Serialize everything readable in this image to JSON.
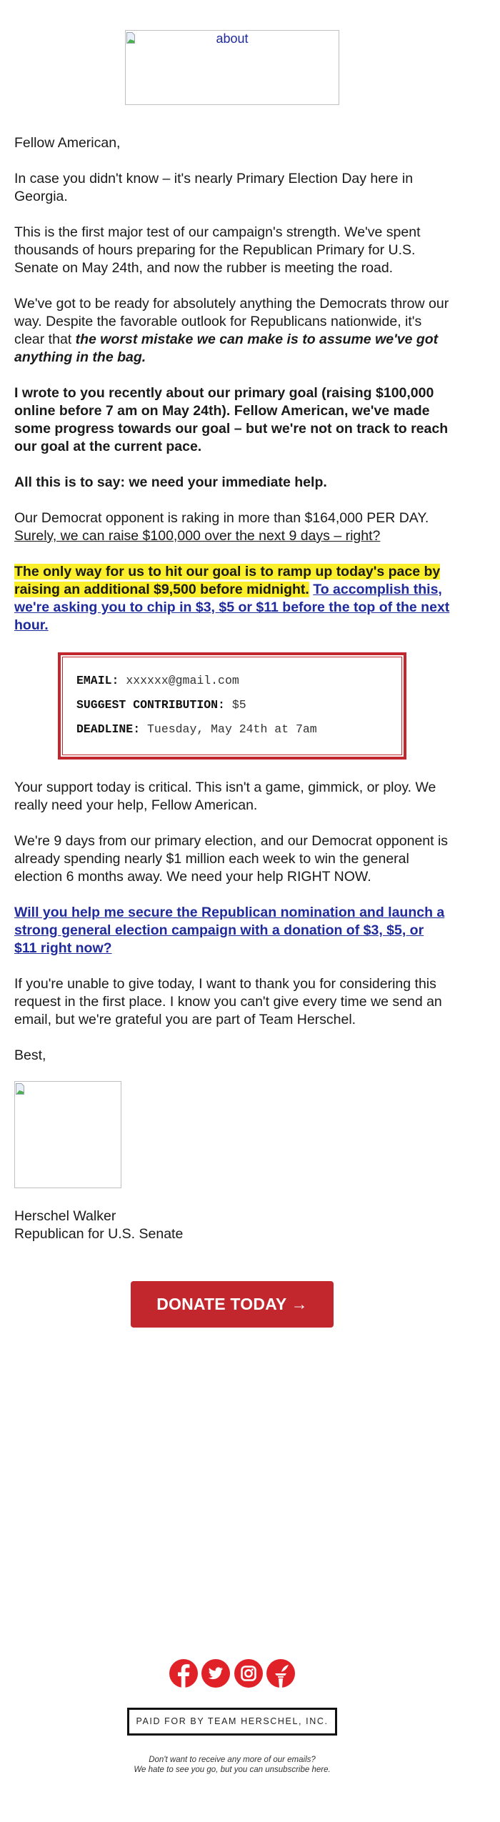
{
  "header": {
    "image_alt": "about"
  },
  "body": {
    "greeting": "Fellow American,",
    "p1": "In case you didn't know – it's nearly Primary Election Day here in Georgia.",
    "p2": "This is the first major test of our campaign's strength. We've spent thousands of hours preparing for the Republican Primary for U.S. Senate on May 24th, and now the rubber is meeting the road.",
    "p3_start": "We've got to be ready for absolutely anything the Democrats throw our way. Despite the favorable outlook for Republicans nationwide, it's clear that ",
    "p3_emphasis": "the worst mistake we can make is to assume we've got anything in the bag.",
    "p4": "I wrote to you recently about our primary goal (raising $100,000 online before 7 am on May 24th). Fellow American, we've made some progress towards our goal – but we're not on track to reach our goal at the current pace.",
    "p5": "All this is to say: we need your immediate help.",
    "p6_line1": "Our Democrat opponent is raking in more than $164,000 PER DAY.",
    "p6_underlined": "Surely, we can raise $100,000 over the next 9 days – right?",
    "p7_highlight": "The only way for us to hit our goal is to ramp up today's pace by raising an additional $9,500 before midnight.",
    "p7_link": "To accomplish this, we're asking you to chip in $3, $5 or $11 before the top of the next hour.",
    "p8": "Your support today is critical. This isn't a game, gimmick, or ploy. We really need your help, Fellow American.",
    "p9": "We're 9 days from our primary election, and our Democrat opponent is already spending nearly $1 million each week to win the general election 6 months away. We need your help RIGHT NOW.",
    "p10_link": "Will you help me secure the Republican nomination and launch a strong general election campaign with a donation of $3, $5, or $11 right now?",
    "p11": "If you're unable to give today, I want to thank you for considering this request in the first place. I know you can't give every time we send an email, but we're grateful you are part of Team Herschel.",
    "signoff": "Best,",
    "signer_name": "Herschel Walker",
    "signer_title": "Republican for U.S. Senate"
  },
  "info_box": {
    "email_label": "EMAIL",
    "email_value": "xxxxxx@gmail.com",
    "contribution_label": "SUGGEST CONTRIBUTION",
    "contribution_value": "$5",
    "deadline_label": "DEADLINE",
    "deadline_value": "Tuesday, May 24th at 7am"
  },
  "donate_button": {
    "label": "DONATE TODAY",
    "arrow": "→",
    "color": "#c1272d"
  },
  "social": {
    "color": "#e02127",
    "icons": [
      "facebook-icon",
      "twitter-icon",
      "instagram-icon",
      "winred-torch-icon"
    ]
  },
  "footer": {
    "paid_for": "PAID FOR BY TEAM HERSCHEL, INC.",
    "unsubscribe_line1": "Don't want to receive any more of our emails?",
    "unsubscribe_line2": "We hate to see you go, but you can unsubscribe here."
  },
  "colors": {
    "link": "#1f2a9b",
    "highlight": "#fbee2a",
    "accent_red": "#c1272d"
  }
}
